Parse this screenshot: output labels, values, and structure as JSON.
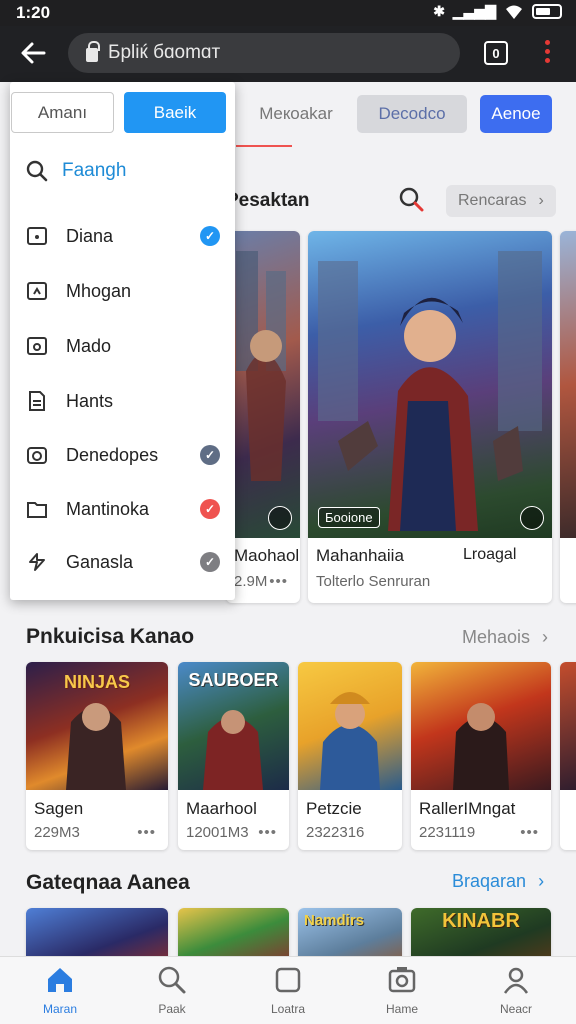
{
  "status": {
    "time": "1:20",
    "bt": "✱",
    "signal": "▁▃▅▇"
  },
  "browser": {
    "url": "Бpliќ бɑomɑт",
    "tab_count": "0"
  },
  "top_buttons": {
    "btn1": "Meкoakar",
    "btn2": "Decodco",
    "btn3": "Aenoe"
  },
  "section1": {
    "title": "Pesaktan",
    "link": "Rencaras"
  },
  "cards1": [
    {
      "name": "Maohaola",
      "meta": "2.9M"
    },
    {
      "name": "Mahanhaiia",
      "name_right": "Lroagal",
      "meta": "Tolterlo Senruran",
      "badge": "Бooione"
    }
  ],
  "section2": {
    "title": "Pnkuicisa Kanao",
    "link": "Mehaois"
  },
  "cards2": [
    {
      "name": "Sagen",
      "meta": "229M3",
      "art_text": "NINJAS"
    },
    {
      "name": "Maarhool",
      "meta": "12001M3",
      "art_text": "SAUBOER"
    },
    {
      "name": "Petzcie",
      "meta": "2322316",
      "art_text": ""
    },
    {
      "name": "RallerIMngat",
      "meta": "2231119",
      "art_text": ""
    }
  ],
  "section3": {
    "title": "Gateqnaa Aanea",
    "link": "Braqaran"
  },
  "cards3_art": [
    "",
    "",
    "Namdirs",
    "KINABR"
  ],
  "dropdown": {
    "btn_left": "Amanı",
    "btn_right": "Baeik",
    "search_label": "Faangh",
    "items": [
      {
        "label": "Diana",
        "check": "blue"
      },
      {
        "label": "Mhogan",
        "check": ""
      },
      {
        "label": "Mado",
        "check": ""
      },
      {
        "label": "Hants",
        "check": ""
      },
      {
        "label": "Denedopes",
        "check": "slate"
      },
      {
        "label": "Mantinoka",
        "check": "red"
      },
      {
        "label": "Ganasla",
        "check": "grey"
      }
    ]
  },
  "bottom_nav": [
    {
      "label": "Maran",
      "icon": "home-icon"
    },
    {
      "label": "Paak",
      "icon": "search-icon"
    },
    {
      "label": "Loatra",
      "icon": "library-icon"
    },
    {
      "label": "Hame",
      "icon": "gallery-icon"
    },
    {
      "label": "Neacr",
      "icon": "profile-icon"
    }
  ],
  "colors": {
    "accent": "#2196f3",
    "active_nav": "#2b7de0",
    "red": "#ef5350"
  }
}
